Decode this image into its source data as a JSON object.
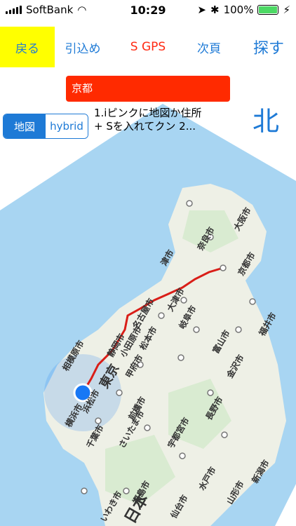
{
  "status": {
    "carrier": "SoftBank",
    "time": "10:29",
    "battery": "100%",
    "battery_level": 1.0
  },
  "toolbar": {
    "back_label": "戻る",
    "pull_label": "引込め",
    "sgps_label": "S GPS",
    "next_label": "次頁",
    "search_label": "探す"
  },
  "place_name": "京都",
  "map_mode": {
    "map_label": "地図",
    "hybrid_label": "hybrid",
    "selected": "地図"
  },
  "info_text": "1.iピンクに地図か住所 + Sを入れてクン 2...",
  "compass_label": "北",
  "map": {
    "city_labels": [
      "大阪市",
      "奈良市",
      "京都市",
      "大津市",
      "津市",
      "名古屋市",
      "岐阜市",
      "富山市",
      "福井市",
      "金沢市",
      "長野市",
      "甲府市",
      "静岡市",
      "浜松市",
      "相模原市",
      "横浜市",
      "東京",
      "前橋市",
      "宇都宮市",
      "水戸市",
      "千葉市",
      "さいたま市",
      "福島市",
      "仙台市",
      "山形市",
      "新潟市",
      "いわき市",
      "日本",
      "松本市",
      "小田原市"
    ],
    "colors": {
      "water": "#a8d5f2",
      "land": "#eef0e6",
      "route": "#d91e18",
      "location": "#1878f5"
    }
  }
}
